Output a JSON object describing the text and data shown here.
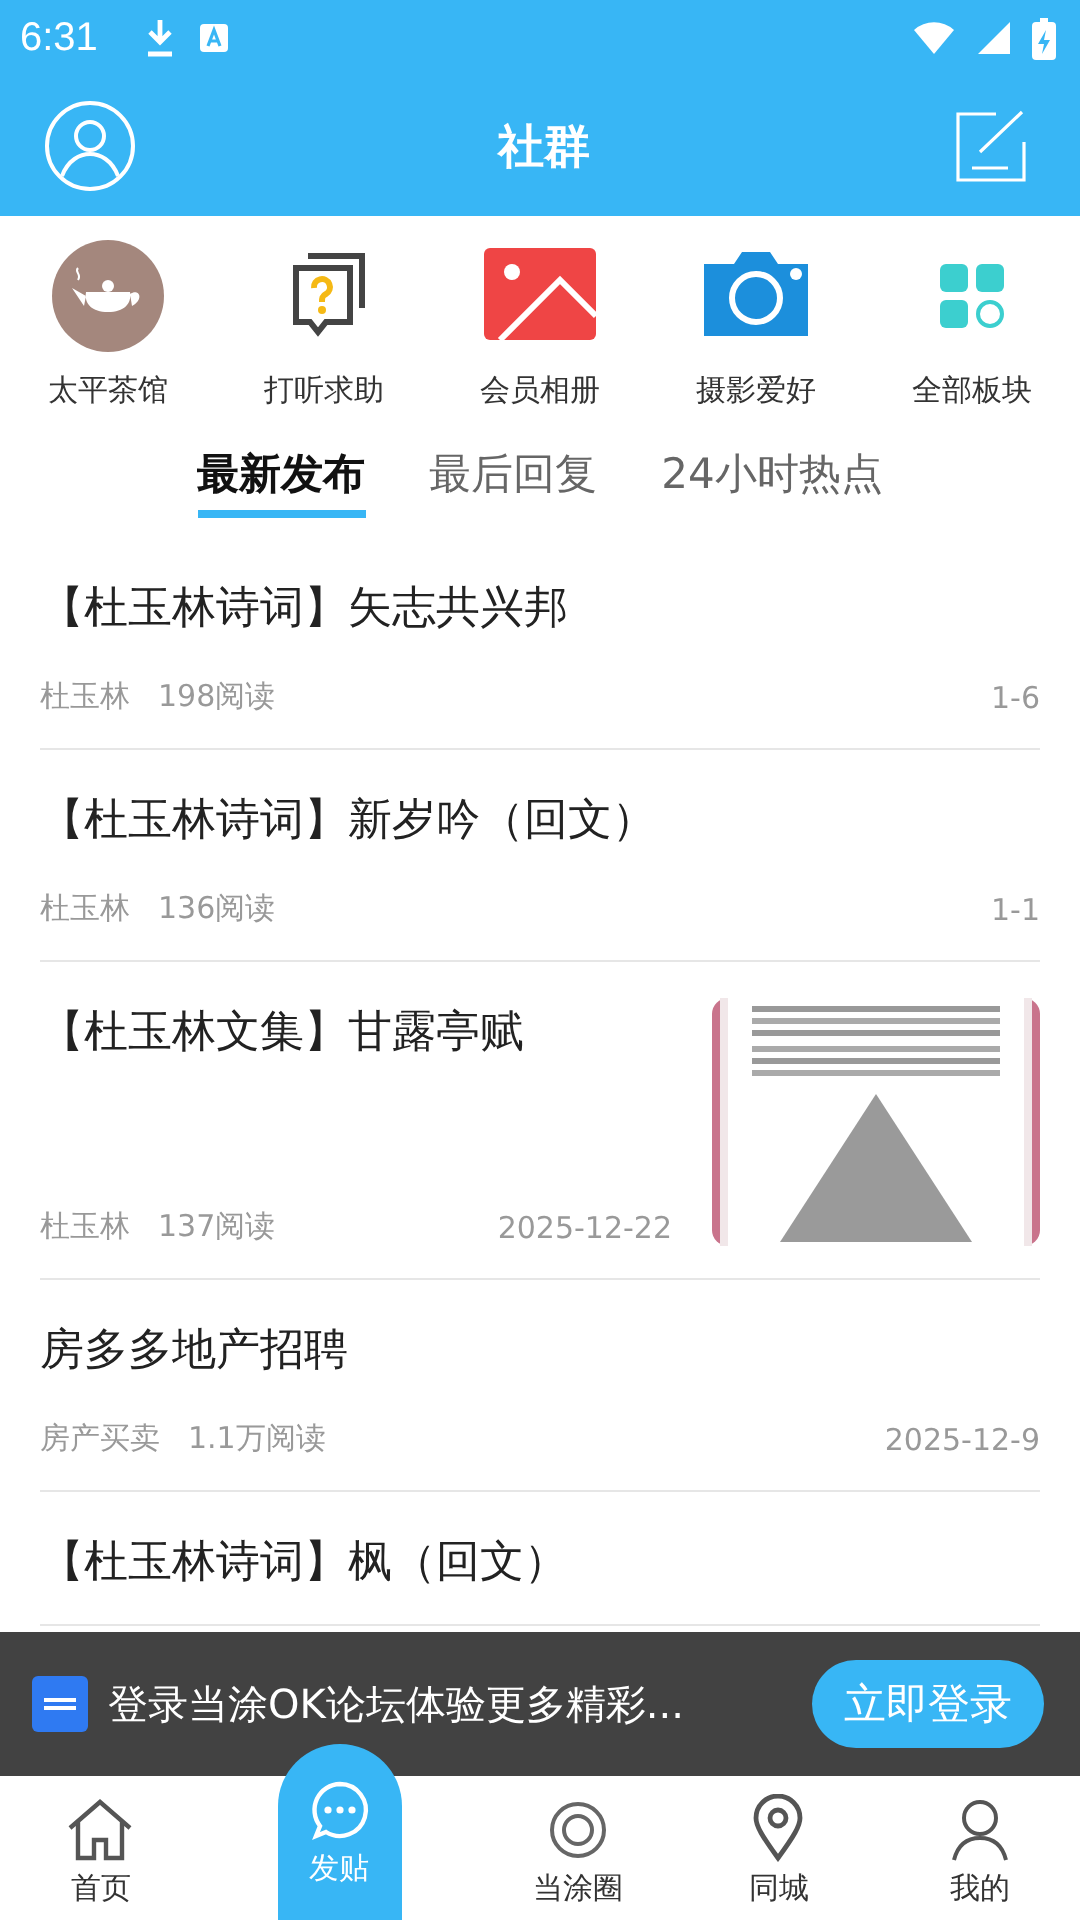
{
  "status_bar": {
    "time": "6:31"
  },
  "header": {
    "title": "社群"
  },
  "categories": [
    {
      "label": "太平茶馆",
      "kind": "teapot"
    },
    {
      "label": "打听求助",
      "kind": "question"
    },
    {
      "label": "会员相册",
      "kind": "album"
    },
    {
      "label": "摄影爱好",
      "kind": "camera"
    },
    {
      "label": "全部板块",
      "kind": "grid"
    }
  ],
  "tabs": [
    {
      "label": "最新发布",
      "selected": true
    },
    {
      "label": "最后回复",
      "selected": false
    },
    {
      "label": "24小时热点",
      "selected": false
    }
  ],
  "posts": [
    {
      "title": "【杜玉林诗词】矢志共兴邦",
      "author": "杜玉林",
      "reads": "198阅读",
      "date": "1-6"
    },
    {
      "title": "【杜玉林诗词】新岁吟（回文）",
      "author": "杜玉林",
      "reads": "136阅读",
      "date": "1-1"
    },
    {
      "title": "【杜玉林文集】甘露亭赋",
      "author": "杜玉林",
      "reads": "137阅读",
      "date": "2025-12-22"
    },
    {
      "title": "房多多地产招聘",
      "author": "房产买卖",
      "reads": "1.1万阅读",
      "date": "2025-12-9"
    },
    {
      "title": "【杜玉林诗词】枫（回文）"
    }
  ],
  "login_banner": {
    "text": "登录当涂OK论坛体验更多精彩...",
    "button": "立即登录"
  },
  "bottom_nav": [
    {
      "label": "首页",
      "kind": "home",
      "selected": false
    },
    {
      "label": "发贴",
      "kind": "post",
      "selected": false
    },
    {
      "label": "当涂圈",
      "kind": "circle",
      "selected": false
    },
    {
      "label": "同城",
      "kind": "pin",
      "selected": false
    },
    {
      "label": "我的",
      "kind": "person",
      "selected": false
    }
  ]
}
